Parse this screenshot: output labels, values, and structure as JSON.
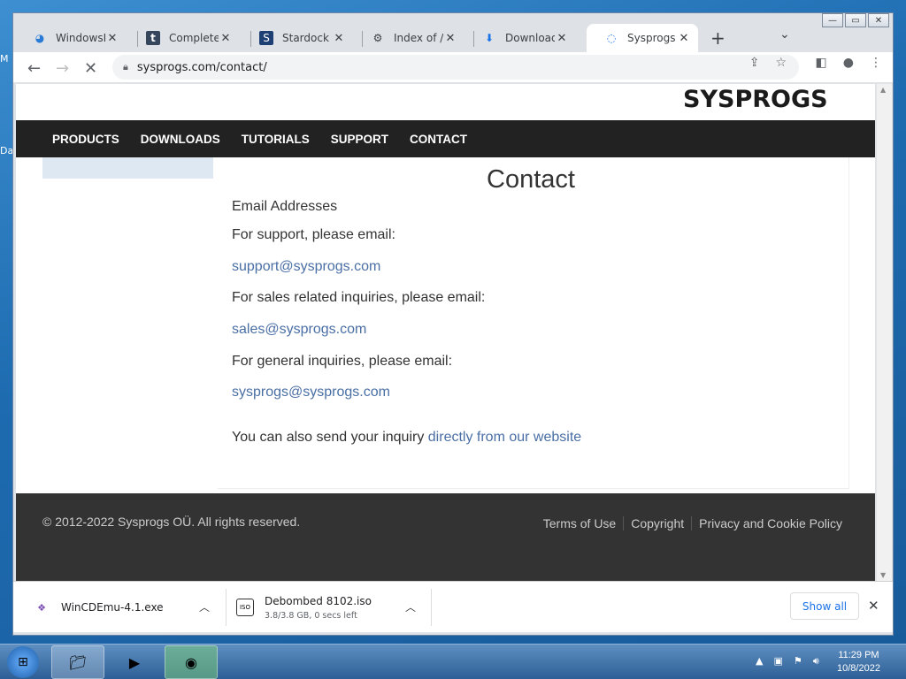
{
  "desktop": {
    "label_top": "M",
    "label_mid": "Da"
  },
  "browser": {
    "tabs": [
      {
        "label": "WindowsBl",
        "icon": "windowsblogitalia-icon"
      },
      {
        "label": "Complete Y",
        "icon": "tumblr-icon"
      },
      {
        "label": "Stardock Ac",
        "icon": "stardock-icon"
      },
      {
        "label": "Index of /~",
        "icon": "index-icon"
      },
      {
        "label": "Downloads",
        "icon": "download-icon"
      },
      {
        "label": "Sysprogs - (",
        "icon": "loading-spinner-icon",
        "active": true
      }
    ],
    "url": "sysprogs.com/contact/"
  },
  "page": {
    "logo": "SYSPROGS",
    "nav": [
      "PRODUCTS",
      "DOWNLOADS",
      "TUTORIALS",
      "SUPPORT",
      "CONTACT"
    ],
    "title": "Contact",
    "section_heading": "Email Addresses",
    "support_text": "For support, please email:",
    "support_email": "support@sysprogs.com",
    "sales_text": "For sales related inquiries, please email:",
    "sales_email": "sales@sysprogs.com",
    "general_text": "For general inquiries, please email:",
    "general_email": "sysprogs@sysprogs.com",
    "inquiry_text": "You can also send your inquiry ",
    "inquiry_link": "directly from our website",
    "footer": {
      "copyright": "© 2012-2022 Sysprogs OÜ. All rights reserved.",
      "links": [
        "Terms of Use",
        "Copyright",
        "Privacy and Cookie Policy"
      ]
    }
  },
  "downloads": [
    {
      "name": "WinCDEmu-4.1.exe",
      "sub": ""
    },
    {
      "name": "Debombed 8102.iso",
      "sub": "3.8/3.8 GB, 0 secs left"
    }
  ],
  "downloads_bar": {
    "show_all": "Show all"
  },
  "taskbar": {
    "time": "11:29 PM",
    "date": "10/8/2022"
  },
  "colors": {
    "nav_bg": "#222222",
    "link": "#4a6fa5",
    "footer_bg": "#333333",
    "accent": "#1a73e8"
  }
}
